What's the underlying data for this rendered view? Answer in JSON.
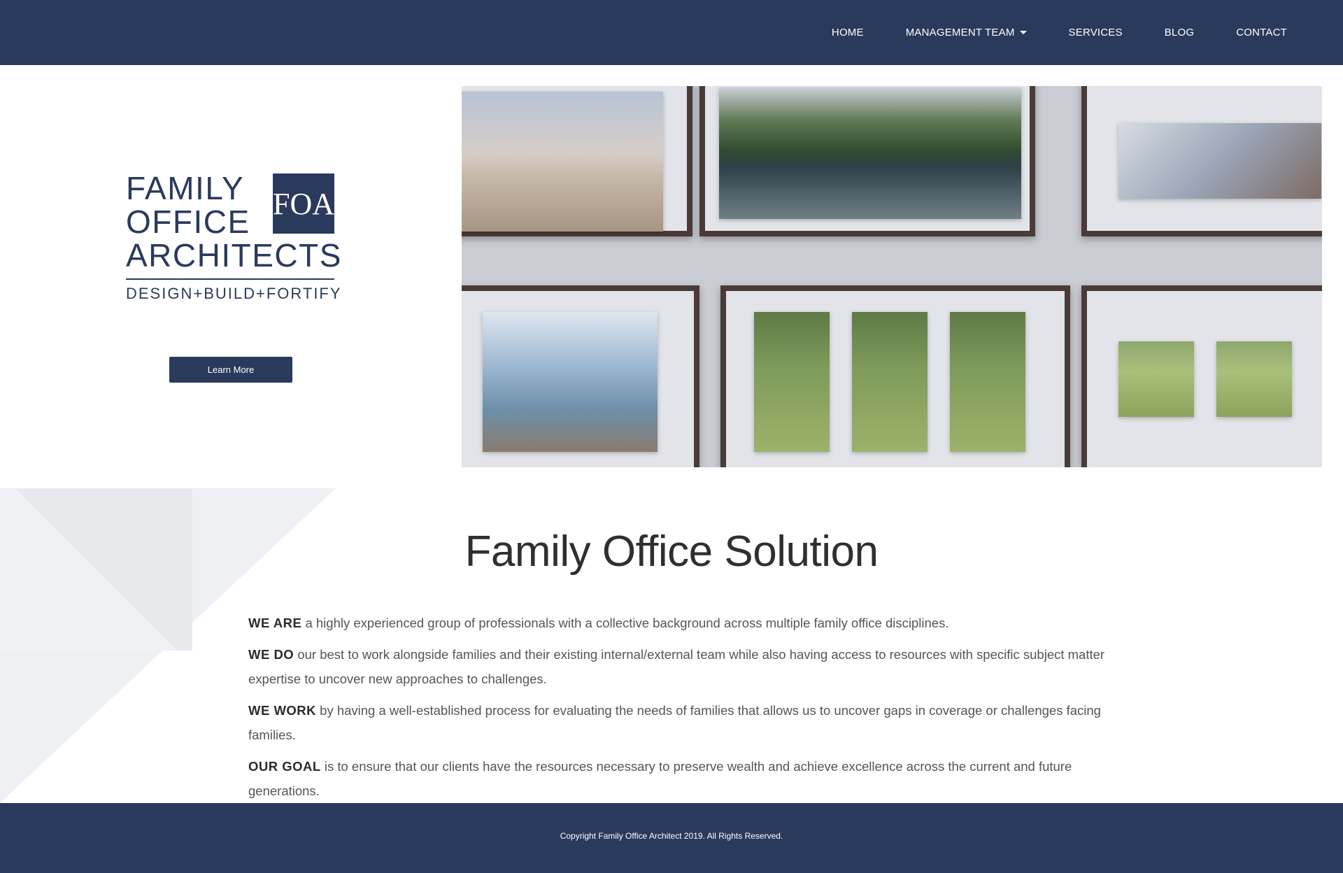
{
  "nav": {
    "items": [
      {
        "label": "HOME",
        "has_dropdown": false
      },
      {
        "label": "MANAGEMENT TEAM",
        "has_dropdown": true
      },
      {
        "label": "SERVICES",
        "has_dropdown": false
      },
      {
        "label": "BLOG",
        "has_dropdown": false
      },
      {
        "label": "CONTACT",
        "has_dropdown": false
      }
    ]
  },
  "hero": {
    "logo": {
      "line1": "FAMILY",
      "line2": "OFFICE",
      "line3": "ARCHITECTS",
      "tagline": "DESIGN+BUILD+FORTIFY",
      "monogram": "FOA"
    },
    "cta_label": "Learn More",
    "image_icon": "photo-collage"
  },
  "solution": {
    "title": "Family Office Solution",
    "paragraphs": [
      {
        "lead": "WE ARE",
        "text": " a highly experienced group of professionals with a collective background across multiple family office disciplines."
      },
      {
        "lead": "WE DO",
        "text": " our best to work alongside families and their existing internal/external team while also having access to resources with specific subject matter expertise to uncover new approaches to challenges."
      },
      {
        "lead": "WE WORK",
        "text": " by having a well-established process for evaluating the needs of families that allows us to uncover gaps in coverage or challenges facing families."
      },
      {
        "lead": "OUR GOAL",
        "text": " is to ensure that our clients have the resources necessary to preserve wealth and achieve excellence across the current and future generations."
      }
    ]
  },
  "footer": {
    "copyright": "Copyright Family Office Architect 2019. All Rights Reserved."
  },
  "colors": {
    "brand_navy": "#2a3a5c",
    "background": "#ffffff",
    "shape_gray": "#eef0f3"
  }
}
